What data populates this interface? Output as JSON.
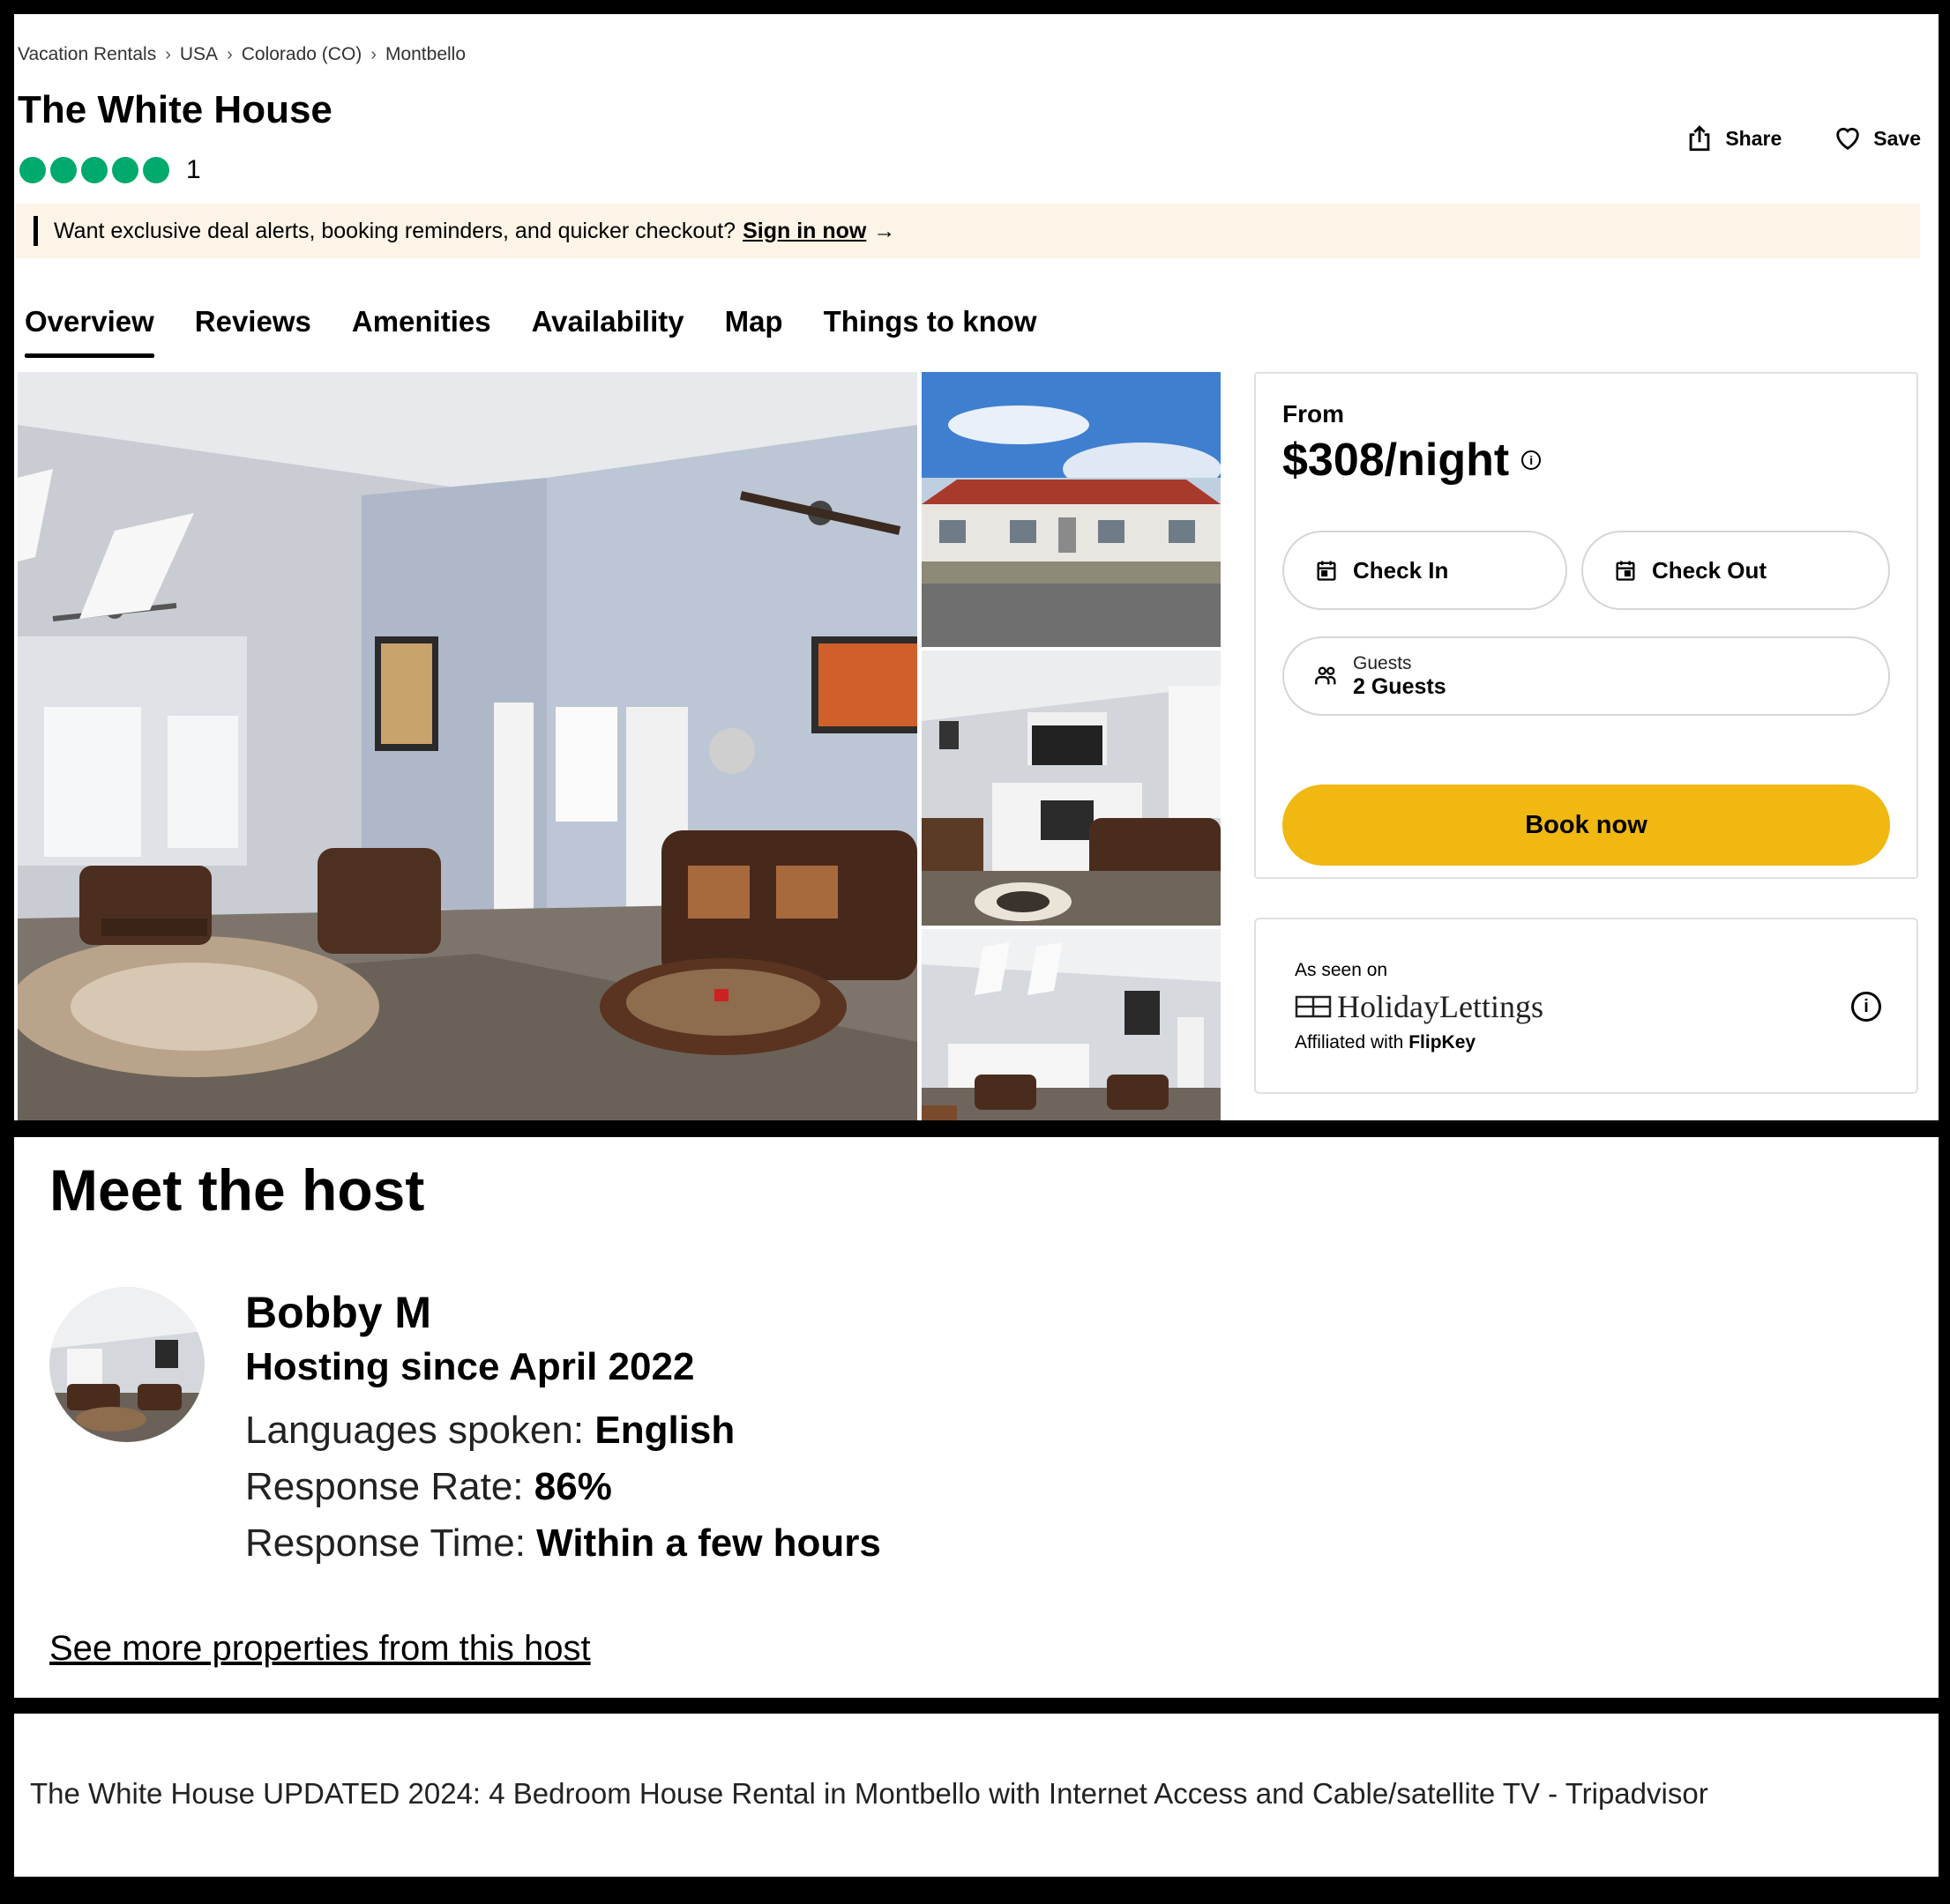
{
  "breadcrumb": [
    "Vacation Rentals",
    "USA",
    "Colorado (CO)",
    "Montbello"
  ],
  "listing": {
    "title": "The White House",
    "rating_bubbles": 5,
    "review_count": "1",
    "share_label": "Share",
    "save_label": "Save"
  },
  "banner": {
    "text": "Want exclusive deal alerts, booking reminders, and quicker checkout?",
    "link": "Sign in now",
    "arrow": "→"
  },
  "tabs": [
    "Overview",
    "Reviews",
    "Amenities",
    "Availability",
    "Map",
    "Things to know"
  ],
  "active_tab": "Overview",
  "booking": {
    "from_label": "From",
    "price": "$308/night",
    "check_in": "Check In",
    "check_out": "Check Out",
    "guests_label": "Guests",
    "guests_value": "2 Guests",
    "book_button": "Book now",
    "book_color": "#f0b810"
  },
  "partner": {
    "seen_label": "As seen on",
    "brand": "HolidayLettings",
    "affiliated_prefix": "Affiliated with",
    "affiliated_brand": "FlipKey"
  },
  "host": {
    "heading": "Meet the host",
    "name": "Bobby M",
    "since": "Hosting since April 2022",
    "languages_label": "Languages spoken:",
    "languages_value": "English",
    "response_rate_label": "Response Rate:",
    "response_rate_value": "86%",
    "response_time_label": "Response Time:",
    "response_time_value": "Within a few hours",
    "more_link": "See more properties from this host"
  },
  "page_title": "The White House UPDATED 2024: 4 Bedroom House Rental in Montbello with Internet Access and Cable/satellite TV - Tripadvisor",
  "colors": {
    "rating_green": "#00aa6c",
    "banner_bg": "#fcf4e6"
  }
}
